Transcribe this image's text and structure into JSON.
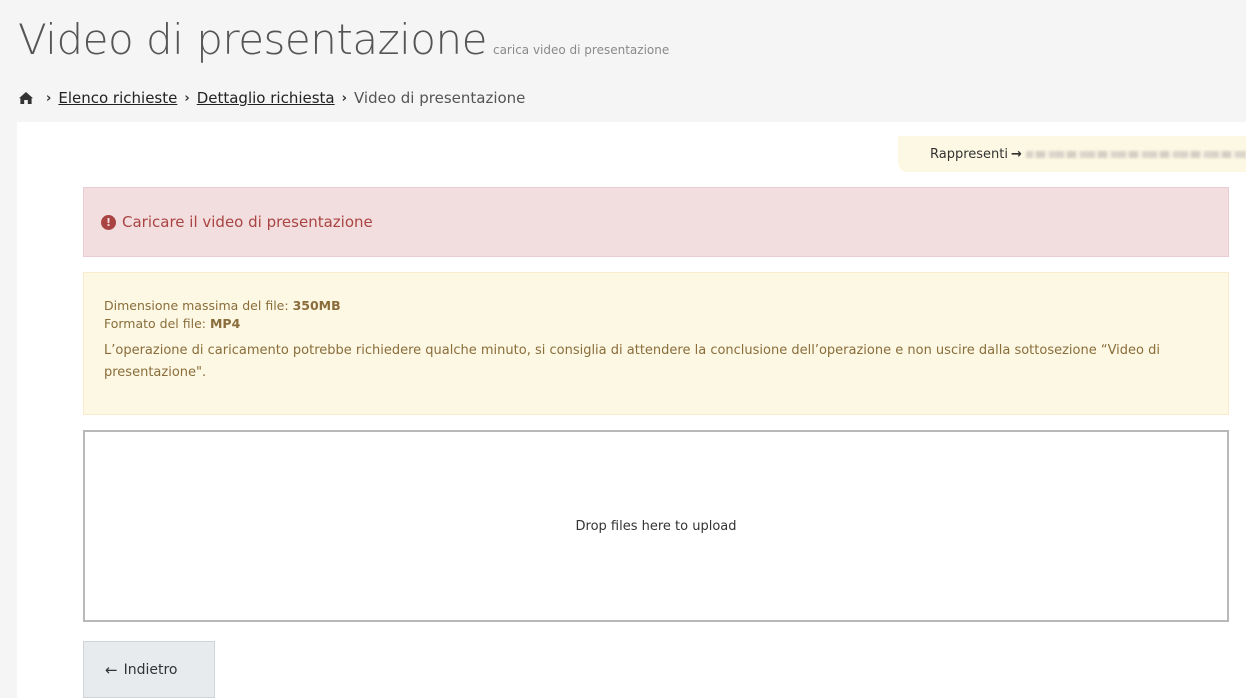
{
  "header": {
    "title": "Video di presentazione",
    "subtitle": "carica video di presentazione"
  },
  "breadcrumb": {
    "items": [
      {
        "label": "Elenco richieste"
      },
      {
        "label": "Dettaglio richiesta"
      }
    ],
    "current": "Video di presentazione"
  },
  "representative": {
    "label": "Rappresenti",
    "arrow": "→"
  },
  "alerts": {
    "danger": {
      "icon": "!",
      "message": "Caricare il video di presentazione"
    },
    "info": {
      "max_size_label": "Dimensione massima del file:",
      "max_size_value": "350MB",
      "format_label": "Formato del file:",
      "format_value": "MP4",
      "note": "L’operazione di caricamento potrebbe richiedere qualche minuto, si consiglia di attendere la conclusione dell’operazione e non uscire dalla sottosezione “Video di presentazione\"."
    }
  },
  "dropzone": {
    "message": "Drop files here to upload"
  },
  "actions": {
    "back_icon": "←",
    "back_label": "Indietro"
  },
  "colors": {
    "danger_bg": "#f2dede",
    "danger_text": "#a94442",
    "warning_bg": "#fcf8e3",
    "warning_text": "#8a6d3b"
  }
}
